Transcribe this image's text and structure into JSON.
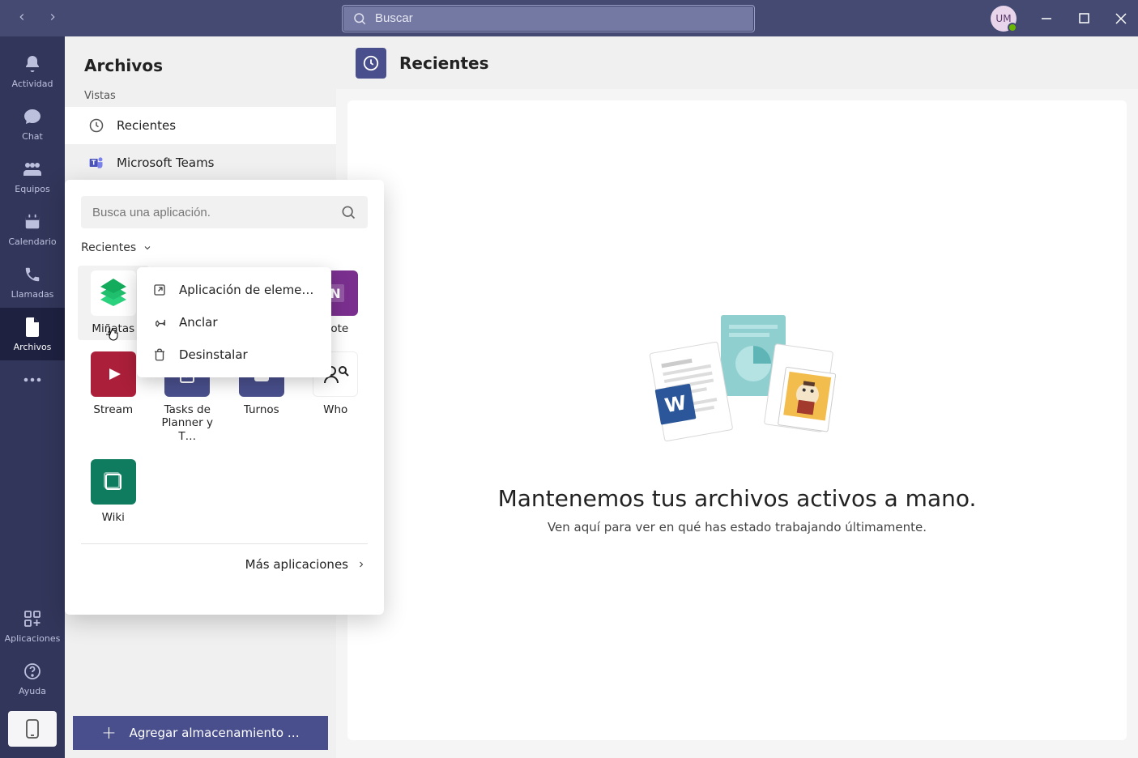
{
  "titlebar": {
    "search_placeholder": "Buscar",
    "avatar_initials": "UM"
  },
  "rail": {
    "items": [
      {
        "id": "actividad",
        "label": "Actividad"
      },
      {
        "id": "chat",
        "label": "Chat"
      },
      {
        "id": "equipos",
        "label": "Equipos"
      },
      {
        "id": "calendario",
        "label": "Calendario"
      },
      {
        "id": "llamadas",
        "label": "Llamadas"
      },
      {
        "id": "archivos",
        "label": "Archivos"
      },
      {
        "id": "more",
        "label": ""
      }
    ],
    "apps_label": "Aplicaciones",
    "help_label": "Ayuda"
  },
  "mid": {
    "title": "Archivos",
    "views_label": "Vistas",
    "rows": [
      {
        "label": "Recientes"
      },
      {
        "label": "Microsoft Teams"
      }
    ],
    "add_storage": "Agregar almacenamiento …"
  },
  "main": {
    "header_title": "Recientes",
    "empty_title": "Mantenemos tus archivos activos a mano.",
    "empty_sub": "Ven aquí para ver en qué has estado trabajando últimamente."
  },
  "flyout": {
    "search_placeholder": "Busca una aplicación.",
    "filter_label": "Recientes",
    "apps": [
      {
        "label": "Miñatas",
        "bg": "#ffffff"
      },
      {
        "label": "Note",
        "bg": "#7a2f8f"
      },
      {
        "label": "Stream",
        "bg": "#ab1f3a"
      },
      {
        "label": "Tasks de Planner y T…",
        "bg": "#494f8c"
      },
      {
        "label": "Turnos",
        "bg": "#494f8c"
      },
      {
        "label": "Who",
        "bg": "#ffffff"
      },
      {
        "label": "Wiki",
        "bg": "#0f7b5f"
      }
    ],
    "more_label": "Más aplicaciones"
  },
  "ctx": {
    "items": [
      {
        "label": "Aplicación de eleme…"
      },
      {
        "label": "Anclar"
      },
      {
        "label": "Desinstalar"
      }
    ]
  }
}
